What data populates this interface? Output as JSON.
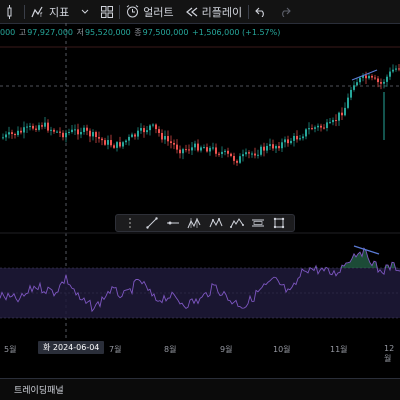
{
  "toolbar": {
    "indicators_label": "지표",
    "alert_label": "얼러트",
    "replay_label": "리플레이"
  },
  "ohlc": {
    "open": "000",
    "high_label": "고",
    "high": "97,927,000",
    "low_label": "저",
    "low": "95,520,000",
    "close_label": "종",
    "close": "97,500,000",
    "change": "+1,506,000 (+1.57%)"
  },
  "xaxis": {
    "labels": [
      "5월",
      "7월",
      "8월",
      "9월",
      "10월",
      "11월",
      "12월"
    ],
    "crosshair_label": "화 2024-06-04"
  },
  "bottom_panel": {
    "label": "트레이딩패널"
  },
  "colors": {
    "up": "#26a69a",
    "down": "#ef5350",
    "rsi": "#7e57c2",
    "rsi_band": "#1e1a3a",
    "background": "#000000"
  },
  "drawing_tools": [
    "grip",
    "trend-line",
    "horizontal-ray",
    "pitchfork",
    "pattern",
    "elliott-wave",
    "parallel-lines",
    "rectangle"
  ]
}
